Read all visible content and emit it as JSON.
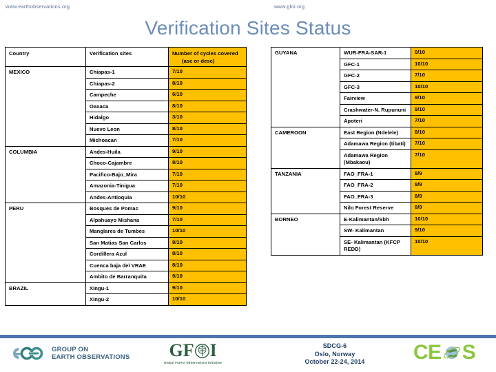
{
  "header": {
    "url_left": "www.earthobservations.org",
    "url_right": "www.gfoi.org",
    "title": "Verification Sites Status"
  },
  "table_left": {
    "columns": [
      "Country",
      "Verification sites",
      "Number of cycles covered (asc or desc)"
    ],
    "header": {
      "country": "Country",
      "sites": "Verification sites",
      "cycles_line1": "Number of cycles covered",
      "cycles_line2": "(asc or desc)"
    },
    "groups": [
      {
        "country": "MEXICO",
        "rows": [
          {
            "site": "Chiapas-1",
            "cycles": "7/10"
          },
          {
            "site": "Chiapas-2",
            "cycles": "8/10"
          },
          {
            "site": "Campeche",
            "cycles": "6/10"
          },
          {
            "site": "Oaxaca",
            "cycles": "8/10"
          },
          {
            "site": "Hidalgo",
            "cycles": "3/10"
          },
          {
            "site": "Nuevo Leon",
            "cycles": "8/10"
          },
          {
            "site": "Michoacan",
            "cycles": "7/10"
          }
        ]
      },
      {
        "country": "COLUMBIA",
        "rows": [
          {
            "site": "Andes-Huila",
            "cycles": "9/10"
          },
          {
            "site": "Choco-Cajambre",
            "cycles": "8/10"
          },
          {
            "site": "Pacifico-Bajo_Mira",
            "cycles": "7/10"
          },
          {
            "site": "Amazonia-Tinigua",
            "cycles": "7/10"
          },
          {
            "site": "Andes-Antioquia",
            "cycles": "10/10"
          }
        ]
      },
      {
        "country": "PERU",
        "rows": [
          {
            "site": "Bosques de Pomac",
            "cycles": "9/10"
          },
          {
            "site": "Alpahuayo Mishana",
            "cycles": "7/10"
          },
          {
            "site": "Manglares de Tumbes",
            "cycles": "10/10"
          },
          {
            "site": "San Matias San Carlos",
            "cycles": "9/10"
          },
          {
            "site": "Cordillera Azul",
            "cycles": "8/10"
          },
          {
            "site": "Cuenca baja del VRAE",
            "cycles": "8/10"
          },
          {
            "site": "Ambito de Barranquita",
            "cycles": "9/10"
          }
        ]
      },
      {
        "country": "BRAZIL",
        "rows": [
          {
            "site": "Xingu-1",
            "cycles": "9/10"
          },
          {
            "site": "Xingu-2",
            "cycles": "10/10"
          }
        ]
      }
    ]
  },
  "table_right": {
    "groups": [
      {
        "country": "GUYANA",
        "rows": [
          {
            "site": "WUR-FRA-SAR-1",
            "cycles": "0/10"
          },
          {
            "site": "GFC-1",
            "cycles": "10/10"
          },
          {
            "site": "GFC-2",
            "cycles": "7/10"
          },
          {
            "site": "GFC-3",
            "cycles": "10/10"
          },
          {
            "site": "Fairview",
            "cycles": "9/10"
          },
          {
            "site": "Crashwater-N. Rupununi",
            "cycles": "9/10"
          },
          {
            "site": "Apoteri",
            "cycles": "7/10"
          }
        ]
      },
      {
        "country": "CAMEROON",
        "rows": [
          {
            "site": "East Region (Ndelele)",
            "cycles": "8/10"
          },
          {
            "site": "Adamawa Region (tibati)",
            "cycles": "7/10"
          },
          {
            "site": "Adamawa Region (Mbakaou)",
            "cycles": "7/10"
          }
        ]
      },
      {
        "country": "TANZANIA",
        "rows": [
          {
            "site": "FAO_FRA-1",
            "cycles": "8/9"
          },
          {
            "site": "FAO_FRA-2",
            "cycles": "8/9"
          },
          {
            "site": "FAO_FRA-3",
            "cycles": "8/9"
          },
          {
            "site": "Nilo Forest Reserve",
            "cycles": "8/9"
          }
        ]
      },
      {
        "country": "BORNEO",
        "rows": [
          {
            "site": "E-Kalimantan/Sbh",
            "cycles": "10/10"
          },
          {
            "site": "SW- Kalimantan",
            "cycles": "9/10"
          },
          {
            "site": "SE- Kalimantan (KFCP REDD)",
            "cycles": "10/10"
          }
        ]
      }
    ]
  },
  "footer": {
    "geo_line1": "GROUP ON",
    "geo_line2": "EARTH OBSERVATIONS",
    "gfoi_letters_left": "GF",
    "gfoi_letters_right": "I",
    "gfoi_tagline": "Global Forest Observations Initiative",
    "event_line1": "SDCG-6",
    "event_line2": "Oslo, Norway",
    "event_line3": "October 22-24, 2014",
    "ceos_left": "CE",
    "ceos_right": "S"
  },
  "colors": {
    "accent_orange": "#FFC000",
    "title_blue": "#6a8cb8",
    "bar_blue": "#4e76ae"
  }
}
